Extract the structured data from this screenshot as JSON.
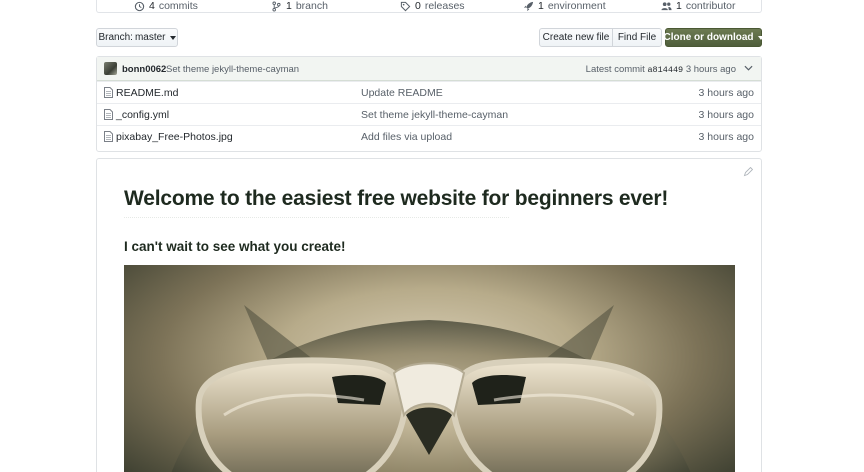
{
  "stats": {
    "commits": {
      "count": "4",
      "label": "commits"
    },
    "branches": {
      "count": "1",
      "label": "branch"
    },
    "releases": {
      "count": "0",
      "label": "releases"
    },
    "environments": {
      "count": "1",
      "label": "environment"
    },
    "contributors": {
      "count": "1",
      "label": "contributor"
    }
  },
  "toolbar": {
    "branch_label": "Branch:",
    "branch_value": "master",
    "create_file_label": "Create new file",
    "find_file_label": "Find File",
    "clone_label": "Clone or download"
  },
  "commit_bar": {
    "author": "bonn0062",
    "message": "Set theme jekyll-theme-cayman",
    "latest_label": "Latest commit",
    "sha": "a814449",
    "age": "3 hours ago"
  },
  "files": [
    {
      "name": "README.md",
      "message": "Update README",
      "age": "3 hours ago"
    },
    {
      "name": "_config.yml",
      "message": "Set theme jekyll-theme-cayman",
      "age": "3 hours ago"
    },
    {
      "name": "pixabay_Free-Photos.jpg",
      "message": "Add files via upload",
      "age": "3 hours ago"
    }
  ],
  "readme": {
    "heading": "Welcome to the easiest free website for beginners ever!",
    "subheading": "I can't wait to see what you create!"
  },
  "colors": {
    "clone_button": "#566440",
    "commit_bar_bg": "#f2f5f2",
    "heading_text": "#1e2a1f"
  }
}
